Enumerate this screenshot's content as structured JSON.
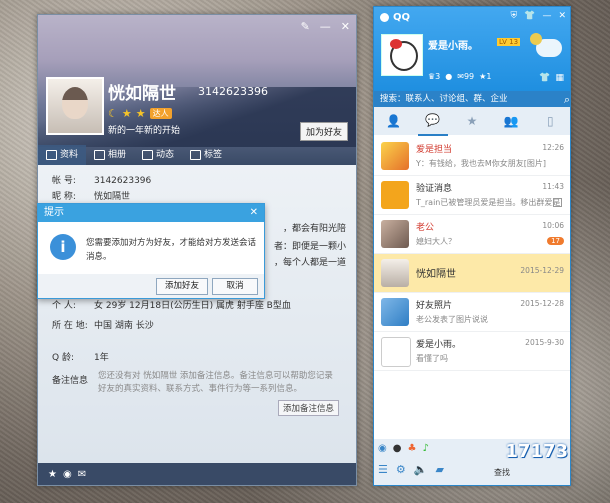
{
  "profile": {
    "nickname": "恍如隔世",
    "qq_number": "3142623396",
    "vip_label": "达人",
    "signature": "新的一年新的开始",
    "add_friend_button": "加为好友",
    "tabs": [
      {
        "label": "资料",
        "icon": "id-card-icon"
      },
      {
        "label": "相册",
        "icon": "album-icon"
      },
      {
        "label": "动态",
        "icon": "feed-icon"
      },
      {
        "label": "标签",
        "icon": "tag-icon"
      }
    ],
    "fields": {
      "account_label": "帐    号:",
      "account_value": "3142623396",
      "nick_label": "昵    称:",
      "nick_value": "恍如隔世",
      "personal_label": "个    人:",
      "personal_value": "女  29岁  12月18日(公历生日)  属虎  射手座  B型血",
      "location_label": "所 在 地:",
      "location_value": "中国 湖南 长沙",
      "qage_label": "Q     龄:",
      "qage_value": "1年",
      "note_label": "备注信息",
      "note_value": "您还没有对 恍如隔世 添加备注信息。备注信息可以帮助您记录好友的真实资料、联系方式、事件行为等一系列信息。",
      "note_button": "添加备注信息"
    },
    "bio_fragments": [
      "，都会有阳光陪",
      "者：即便是一颗小",
      "，每个人都是一道"
    ]
  },
  "dialog": {
    "title": "提示",
    "message": "您需要添加对方为好友，才能给对方发送会话消息。",
    "confirm": "添加好友",
    "cancel": "取消"
  },
  "qq": {
    "title": "QQ",
    "user_name": "爱是小雨。",
    "level_badge": "LV 13",
    "stats": [
      "3",
      "99",
      "1"
    ],
    "search_placeholder": "搜索：联系人、讨论组、群、企业",
    "chats": [
      {
        "name": "爱是担当",
        "time": "12:26",
        "message": "Y：有钱给，我也去M你女朋友[图片]",
        "name_red": true
      },
      {
        "name": "验证消息",
        "time": "11:43",
        "message": "T_rain已被管理员爱是担当。移出群爱是",
        "name_red": false
      },
      {
        "name": "老公",
        "time": "10:06",
        "message": "媳妇大人？",
        "name_red": true,
        "count": "17"
      },
      {
        "name": "恍如隔世",
        "time": "2015-12-29",
        "message": "",
        "name_red": false
      },
      {
        "name": "好友照片",
        "time": "2015-12-28",
        "message": "老公发表了图片说说",
        "name_red": false
      },
      {
        "name": "爱是小雨。",
        "time": "2015-9-30",
        "message": "看懂了吗",
        "name_red": false
      }
    ],
    "find_label": "查找",
    "watermark": "17173"
  }
}
